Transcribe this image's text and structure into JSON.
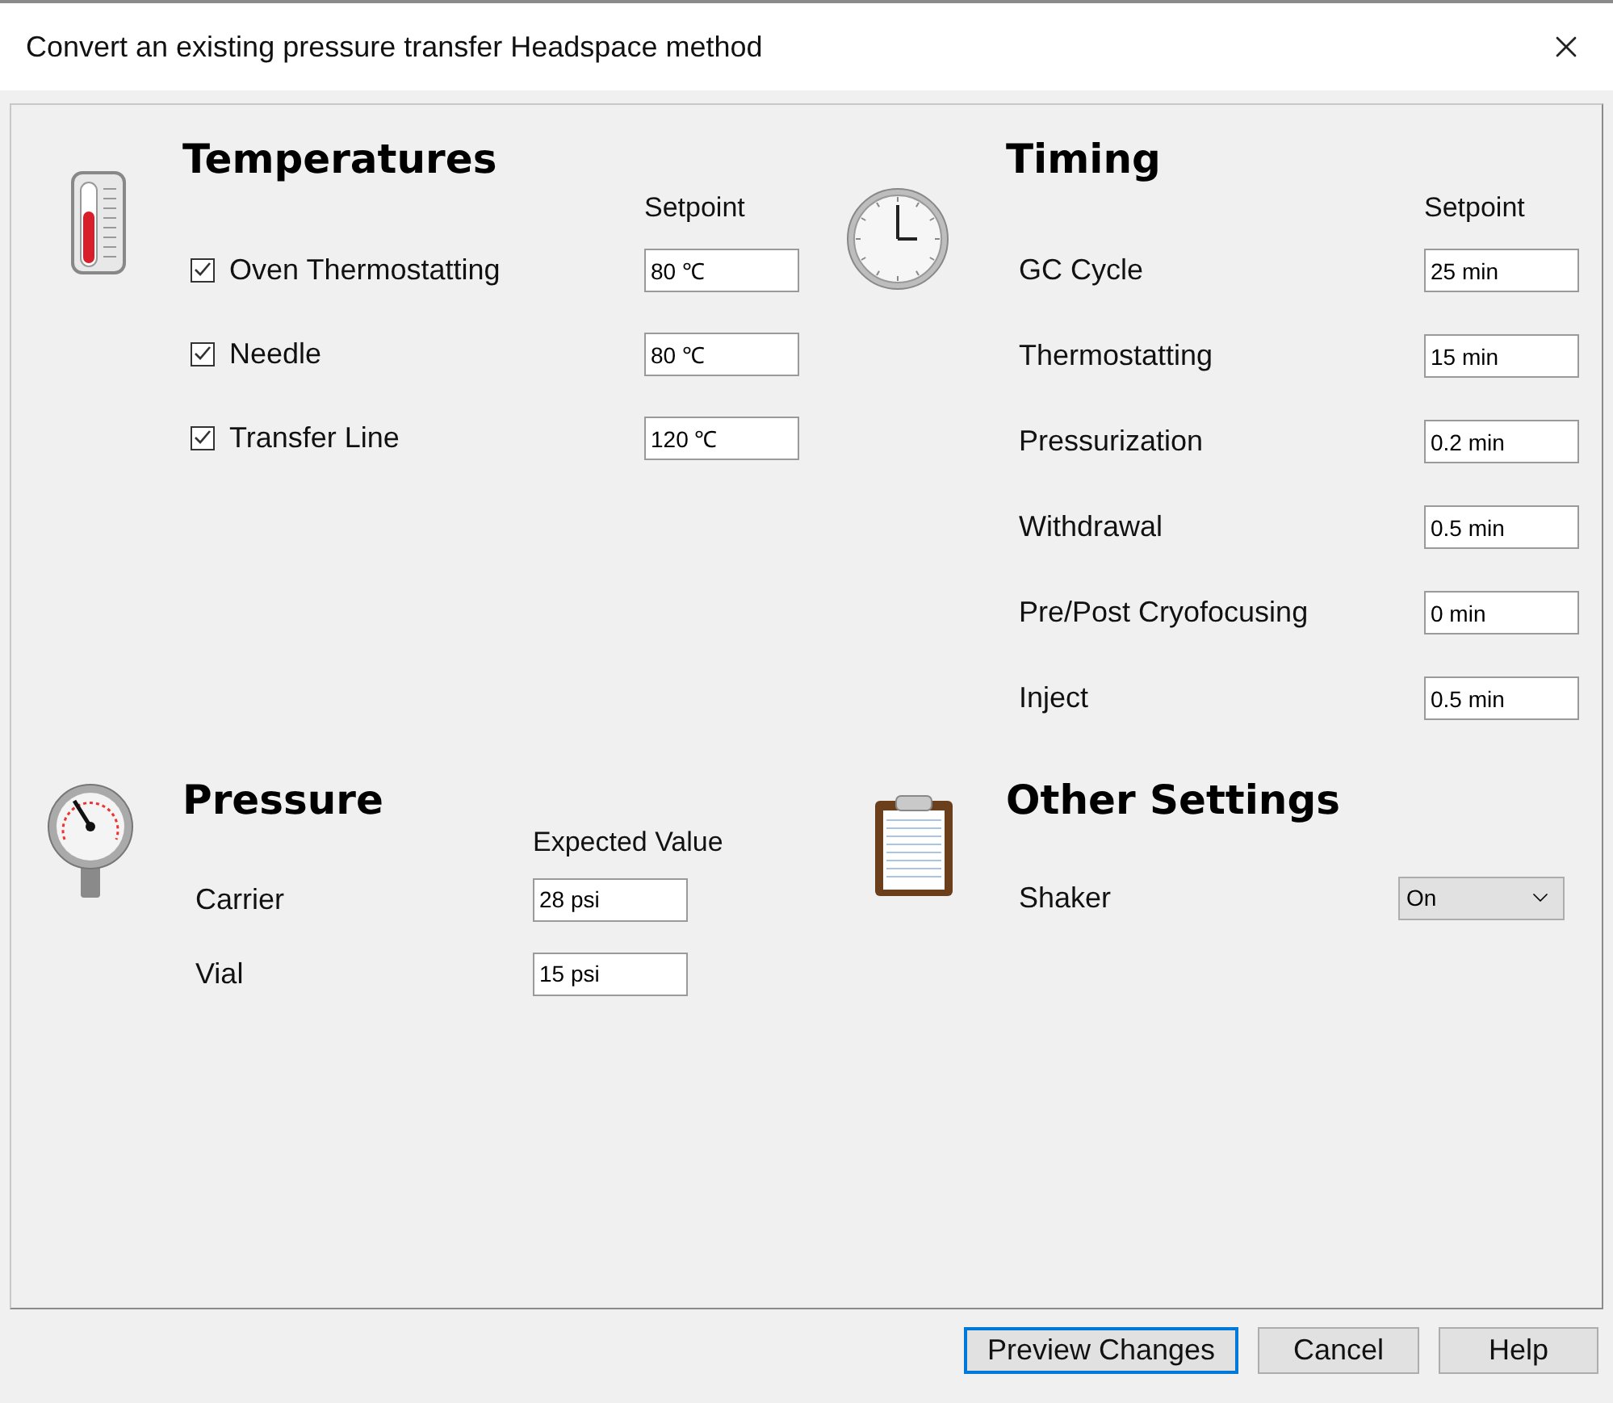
{
  "window": {
    "title": "Convert an existing pressure transfer Headspace method"
  },
  "sections": [
    {
      "kind": "thermometer",
      "title": "Temperatures",
      "column_header": "Setpoint",
      "rows": [
        {
          "kind": "checkbox",
          "label": "Oven Thermostatting",
          "checked": true,
          "value": "80 ℃"
        },
        {
          "kind": "checkbox",
          "label": "Needle",
          "checked": true,
          "value": "80 ℃"
        },
        {
          "kind": "checkbox",
          "label": "Transfer Line",
          "checked": true,
          "value": "120 ℃"
        }
      ]
    },
    {
      "kind": "clock",
      "title": "Timing",
      "column_header": "Setpoint",
      "rows": [
        {
          "kind": "field",
          "label": "GC Cycle",
          "value": "25 min"
        },
        {
          "kind": "field",
          "label": "Thermostatting",
          "value": "15 min"
        },
        {
          "kind": "field",
          "label": "Pressurization",
          "value": "0.2 min"
        },
        {
          "kind": "field",
          "label": "Withdrawal",
          "value": "0.5 min"
        },
        {
          "kind": "field",
          "label": "Pre/Post Cryofocusing",
          "value": "0 min"
        },
        {
          "kind": "field",
          "label": "Inject",
          "value": "0.5 min"
        }
      ]
    },
    {
      "kind": "gauge",
      "title": "Pressure",
      "column_header": "Expected Value",
      "rows": [
        {
          "kind": "field",
          "label": "Carrier",
          "value": "28 psi"
        },
        {
          "kind": "field",
          "label": "Vial",
          "value": "15 psi"
        }
      ]
    },
    {
      "kind": "clipboard",
      "title": "Other Settings",
      "rows": [
        {
          "kind": "dropdown",
          "label": "Shaker",
          "value": "On"
        }
      ]
    }
  ],
  "buttons": [
    {
      "label": "Preview Changes",
      "focused": true
    },
    {
      "label": "Cancel",
      "focused": false
    },
    {
      "label": "Help",
      "focused": false
    }
  ]
}
